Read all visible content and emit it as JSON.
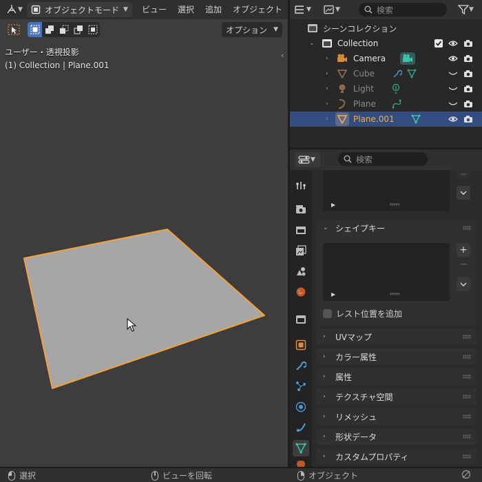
{
  "viewport": {
    "mode_label": "オブジェクトモード",
    "menus": [
      "ビュー",
      "選択",
      "追加",
      "オブジェクト"
    ],
    "options_label": "オプション",
    "view_info": "ユーザー・透視投影",
    "object_info": "(1) Collection | Plane.001"
  },
  "outliner": {
    "search_placeholder": "検索",
    "scene_collection": "シーンコレクション",
    "collection": "Collection",
    "objects": [
      {
        "name": "Camera",
        "type": "camera",
        "visible": true
      },
      {
        "name": "Cube",
        "type": "mesh",
        "visible": false
      },
      {
        "name": "Light",
        "type": "light",
        "visible": false
      },
      {
        "name": "Plane",
        "type": "curve",
        "visible": false
      },
      {
        "name": "Plane.001",
        "type": "mesh",
        "visible": true,
        "selected": true
      }
    ]
  },
  "properties": {
    "search_placeholder": "検索",
    "shape_keys_label": "シェイプキー",
    "rest_position_label": "レスト位置を追加",
    "panels": [
      "UVマップ",
      "カラー属性",
      "属性",
      "テクスチャ空間",
      "リメッシュ",
      "形状データ",
      "カスタムプロパティ"
    ]
  },
  "status": {
    "select": "選択",
    "rotate": "ビューを回転",
    "object": "オブジェクト"
  },
  "colors": {
    "selection_orange": "#f5a03a",
    "active_blue": "#4772b3",
    "row_selected": "#334d80",
    "mesh_green": "#3fc0a8",
    "object_orange": "#f0a050"
  }
}
